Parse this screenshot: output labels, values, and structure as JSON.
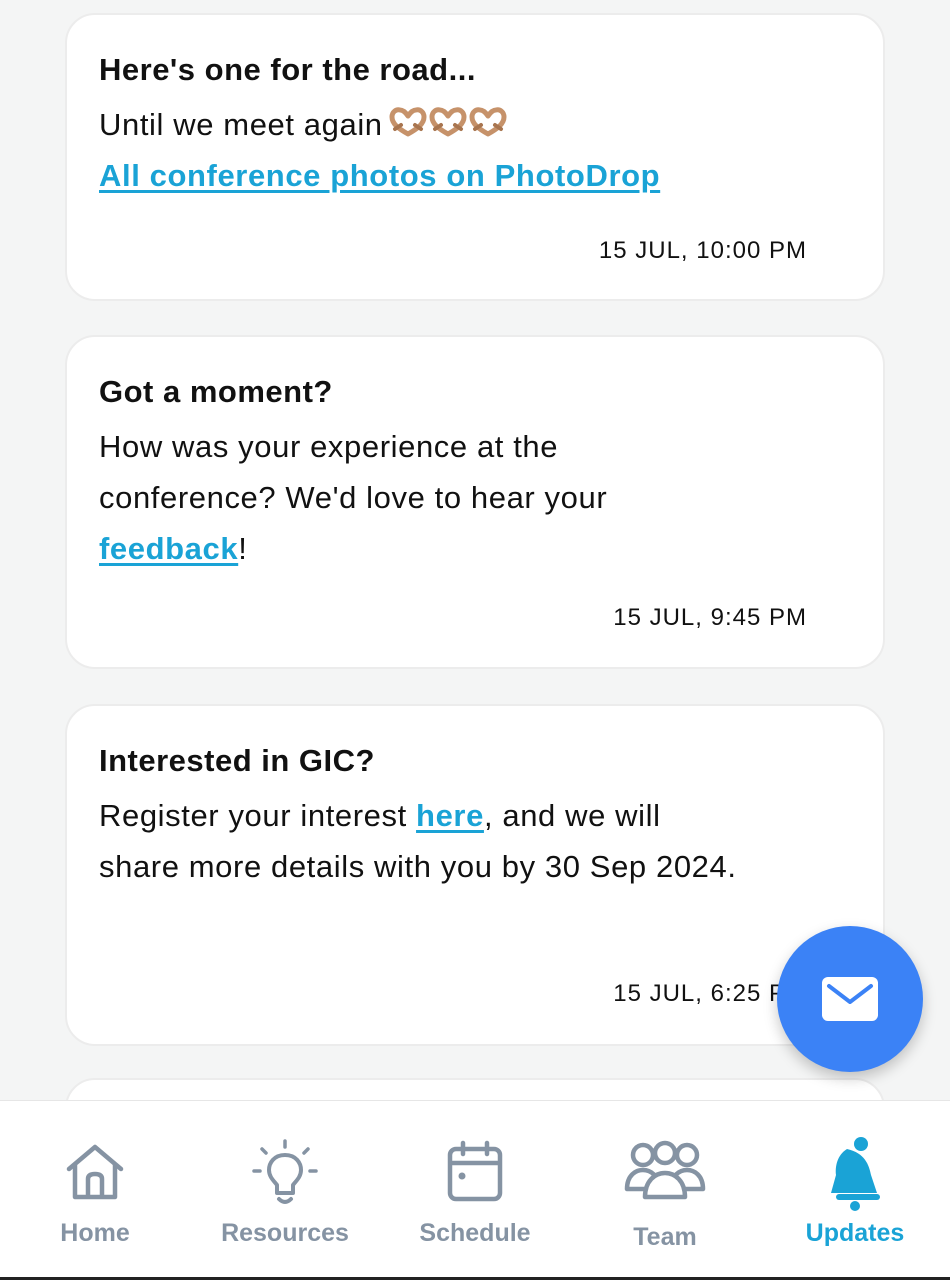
{
  "messages": [
    {
      "title": "Here's one for the road...",
      "body_text": "Until we meet again",
      "emoji": "heart-hands",
      "link_text": "All conference photos on PhotoDrop",
      "time": "15 JUL, 10:00 PM"
    },
    {
      "title": "Got a moment?",
      "body_text": "How was your experience at the conference? We'd love to hear your",
      "link_text": "feedback",
      "body_suffix": "!",
      "time": "15 JUL, 9:45 PM"
    },
    {
      "title": "Interested in GIC?",
      "body_prefix": "Register your interest",
      "link_text": "here",
      "body_suffix": ", and we will share more details with you by 30 Sep 2024.",
      "time": "15 JUL, 6:25 PM"
    }
  ],
  "fab": {
    "icon": "mail-icon"
  },
  "tabs": [
    {
      "label": "Home",
      "icon": "home-icon"
    },
    {
      "label": "Resources",
      "icon": "lightbulb-icon"
    },
    {
      "label": "Schedule",
      "icon": "calendar-icon"
    },
    {
      "label": "Team",
      "icon": "team-icon"
    },
    {
      "label": "Updates",
      "icon": "bell-icon",
      "active": true
    }
  ],
  "colors": {
    "accent": "#1aa3d6",
    "fab": "#3b82f6",
    "inactive_tab": "#8593a3",
    "background": "#f4f5f5"
  }
}
